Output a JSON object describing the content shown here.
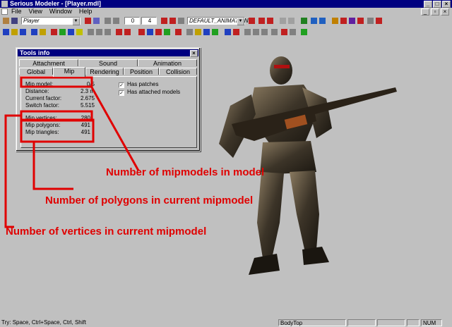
{
  "window": {
    "title": "Serious Modeler - [Player.mdl]"
  },
  "menu": [
    "File",
    "View",
    "Window",
    "Help"
  ],
  "toolbar": {
    "model_combo": "Player",
    "frame_value": "0",
    "frame_count": "4",
    "animation_combo": "DEFAULT_ANIMATION"
  },
  "tools_info": {
    "title": "Tools info",
    "tabs_row1": [
      "Attachment",
      "Sound",
      "Animation"
    ],
    "tabs_row2": [
      "Global",
      "Mip",
      "Rendering",
      "Position",
      "Collision"
    ],
    "active_tab": "Mip",
    "fields": [
      {
        "label": "Mip model:",
        "value": "0/5"
      },
      {
        "label": "Distance:",
        "value": "2.3 m"
      },
      {
        "label": "Current factor:",
        "value": "2.675"
      },
      {
        "label": "Switch factor:",
        "value": "5.515"
      }
    ],
    "fields2": [
      {
        "label": "Mip vertices:",
        "value": "280"
      },
      {
        "label": "Mip polygons:",
        "value": "491"
      },
      {
        "label": "Mip triangles:",
        "value": "491"
      }
    ],
    "checkboxes": [
      {
        "label": "Has patches",
        "checked": true
      },
      {
        "label": "Has attached models",
        "checked": true
      }
    ]
  },
  "annotations": [
    "Number of mipmodels in model",
    "Number of polygons in current mipmodel",
    "Number of vertices in current mipmodel"
  ],
  "annotation_color": "#e00000",
  "statusbar": {
    "hint": "Try: Space, Ctrl+Space, Ctrl, Shift",
    "bone": "BodyTop",
    "num": "NUM"
  }
}
